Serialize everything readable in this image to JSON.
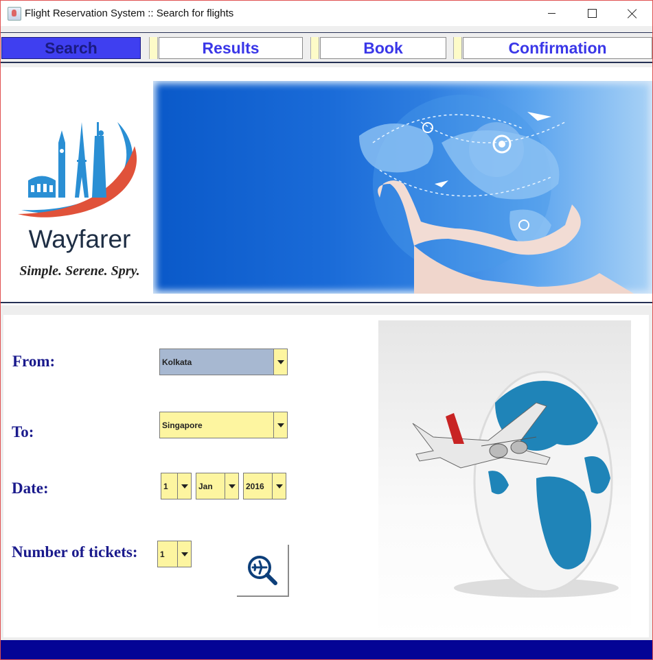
{
  "window": {
    "title": "Flight Reservation System :: Search for flights",
    "icon": "java-cup-icon",
    "controls": [
      "minimize",
      "maximize",
      "close"
    ]
  },
  "tabs": [
    {
      "label": "Search",
      "active": true
    },
    {
      "label": "Results",
      "active": false
    },
    {
      "label": "Book",
      "active": false
    },
    {
      "label": "Confirmation",
      "active": false
    }
  ],
  "brand": {
    "name": "Wayfarer",
    "tagline": "Simple. Serene. Spry."
  },
  "form": {
    "from_label": "From:",
    "from_value": "Kolkata",
    "to_label": "To:",
    "to_value": "Singapore",
    "date_label": "Date:",
    "date_day": "1",
    "date_month": "Jan",
    "date_year": "2016",
    "tickets_label": "Number of tickets:",
    "tickets_value": "1",
    "search_icon": "flight-search-icon"
  },
  "colors": {
    "tab_text": "#3a37e8",
    "tab_active_bg": "#3f3ff0",
    "label_text": "#1a1a8c",
    "combo_bg": "#fdf5a0",
    "combo_from_bg": "#a7b8d1",
    "footer": "#040495"
  }
}
